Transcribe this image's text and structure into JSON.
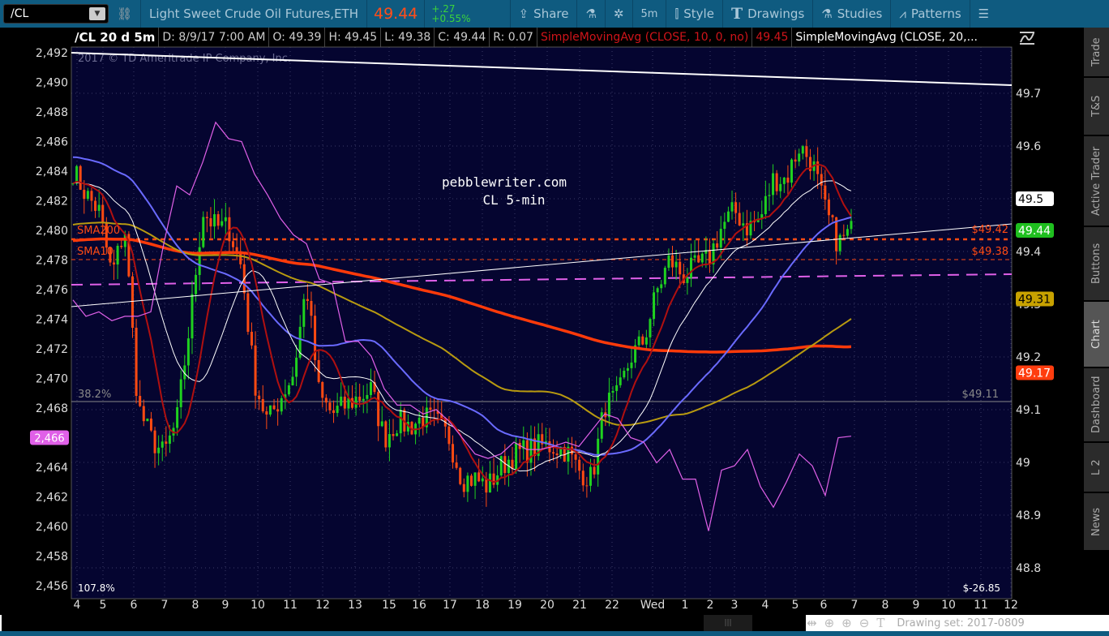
{
  "toolbar": {
    "symbol": "/CL",
    "description": "Light Sweet Crude Oil Futures,ETH",
    "last": "49.44",
    "change": "+.27",
    "change_pct": "+0.55%",
    "share": "Share",
    "interval": "5m",
    "style": "Style",
    "drawings": "Drawings",
    "studies": "Studies",
    "patterns": "Patterns"
  },
  "info": {
    "title": "/CL 20 d 5m",
    "date": "D: 8/9/17 7:00 AM",
    "open": "O: 49.39",
    "high": "H: 49.45",
    "low": "L: 49.38",
    "close": "C: 49.44",
    "range": "R: 0.07",
    "sma10": "SimpleMovingAvg (CLOSE, 10, 0, no)",
    "sma10_val": "49.45",
    "sma20": "SimpleMovingAvg (CLOSE, 20,..."
  },
  "chart": {
    "watermark": "2017 © TD Ameritrade IP Company, Inc.",
    "note1": "pebblewriter.com",
    "note2": "CL 5-min",
    "sma200_label": "SMA200",
    "sma10_label": "SMA10",
    "fib_label": "38.2%",
    "fib_price": "$49.11",
    "level1": "$49.42",
    "level2": "$49.38",
    "bottom_left": "107.8%",
    "bottom_right": "$-26.85",
    "left_ticks": [
      "2,492",
      "2,490",
      "2,488",
      "2,486",
      "2,484",
      "2,482",
      "2,480",
      "2,478",
      "2,476",
      "2,474",
      "2,472",
      "2,470",
      "2,468",
      "2,466",
      "2,464",
      "2,462",
      "2,460",
      "2,458",
      "2,456"
    ],
    "left_ticks_values": [
      2492,
      2490,
      2488,
      2486,
      2484,
      2482,
      2480,
      2478,
      2476,
      2474,
      2472,
      2470,
      2468,
      2466,
      2464,
      2462,
      2460,
      2458,
      2456
    ],
    "left_tag": "2,466",
    "right_ticks": [
      "49.7",
      "49.6",
      "49.5",
      "49.4",
      "49.3",
      "49.2",
      "49.1",
      "49",
      "48.9",
      "48.8"
    ],
    "right_ticks_values": [
      49.7,
      49.6,
      49.5,
      49.4,
      49.3,
      49.2,
      49.1,
      49.0,
      48.9,
      48.8
    ],
    "tags": [
      {
        "text": "49.5",
        "value": 49.5,
        "bg": "#ffffff",
        "fg": "#000000"
      },
      {
        "text": "49.44",
        "value": 49.44,
        "bg": "#1fbf1f",
        "fg": "#ffffff"
      },
      {
        "text": "49.31",
        "value": 49.31,
        "bg": "#c8a200",
        "fg": "#000000"
      },
      {
        "text": "49.17",
        "value": 49.17,
        "bg": "#ff3d0f",
        "fg": "#ffffff"
      }
    ],
    "x_labels": [
      "4",
      "5",
      "6",
      "7",
      "8",
      "9",
      "10",
      "11",
      "12",
      "13",
      "15",
      "16",
      "17",
      "18",
      "19",
      "20",
      "21",
      "22",
      "Wed",
      "1",
      "2",
      "3",
      "4",
      "5",
      "6",
      "7",
      "8",
      "9",
      "10",
      "11",
      "12"
    ],
    "price_path": [
      49.554,
      49.508,
      49.477,
      49.354,
      49.446,
      49.108,
      49.046,
      49.015,
      49.077,
      49.262,
      49.477,
      49.446,
      49.446,
      49.369,
      49.154,
      49.077,
      49.123,
      49.169,
      49.338,
      49.123,
      49.092,
      49.108,
      49.123,
      49.138,
      49.046,
      49.077,
      49.069,
      49.085,
      49.077,
      49.046,
      48.969,
      48.969,
      48.954,
      48.992,
      49.015,
      49.023,
      49.031,
      49.031,
      49.023,
      48.985,
      48.969,
      49.108,
      49.123,
      49.2,
      49.231,
      49.323,
      49.385,
      49.354,
      49.369,
      49.385,
      49.446,
      49.477,
      49.446,
      49.462,
      49.538,
      49.538,
      49.6,
      49.569,
      49.477,
      49.415,
      49.438
    ],
    "overlay_path": [
      2475.3,
      2474.2,
      2474.5,
      2473.9,
      2474.2,
      2474.2,
      2474.5,
      2479.1,
      2483.0,
      2482.4,
      2484.6,
      2487.3,
      2486.2,
      2486.0,
      2483.8,
      2482.4,
      2480.8,
      2479.7,
      2479.1,
      2476.7,
      2476.4,
      2472.5,
      2472.5,
      2471.5,
      2469.3,
      2468.2,
      2468.2,
      2467.6,
      2467.9,
      2467.1,
      2466.0,
      2464.9,
      2464.6,
      2464.9,
      2465.7,
      2465.2,
      2465.2,
      2465.4,
      2465.7,
      2465.4,
      2466.5,
      2467.6,
      2467.3,
      2466.0,
      2465.7,
      2464.3,
      2465.2,
      2463.2,
      2463.2,
      2459.7,
      2463.8,
      2464.1,
      2465.2,
      2462.7,
      2461.3,
      2463.0,
      2464.9,
      2464.1,
      2462.1,
      2466.0,
      2466.1
    ],
    "colors": {
      "bg": "#050530",
      "up": "#1fd11f",
      "down": "#ff4a12",
      "sma10": "#b01010",
      "sma20": "#ffffff",
      "sma50": "#6a6aff",
      "sma100": "#b89a10",
      "sma200": "#ff3a0a",
      "overlay": "#e060e8"
    }
  },
  "sidetabs": [
    "Trade",
    "T&S",
    "Active Trader",
    "Buttons",
    "Chart",
    "Dashboard",
    "L 2",
    "News"
  ],
  "bottom": {
    "drawing_set": "Drawing set: 2017-0809"
  }
}
